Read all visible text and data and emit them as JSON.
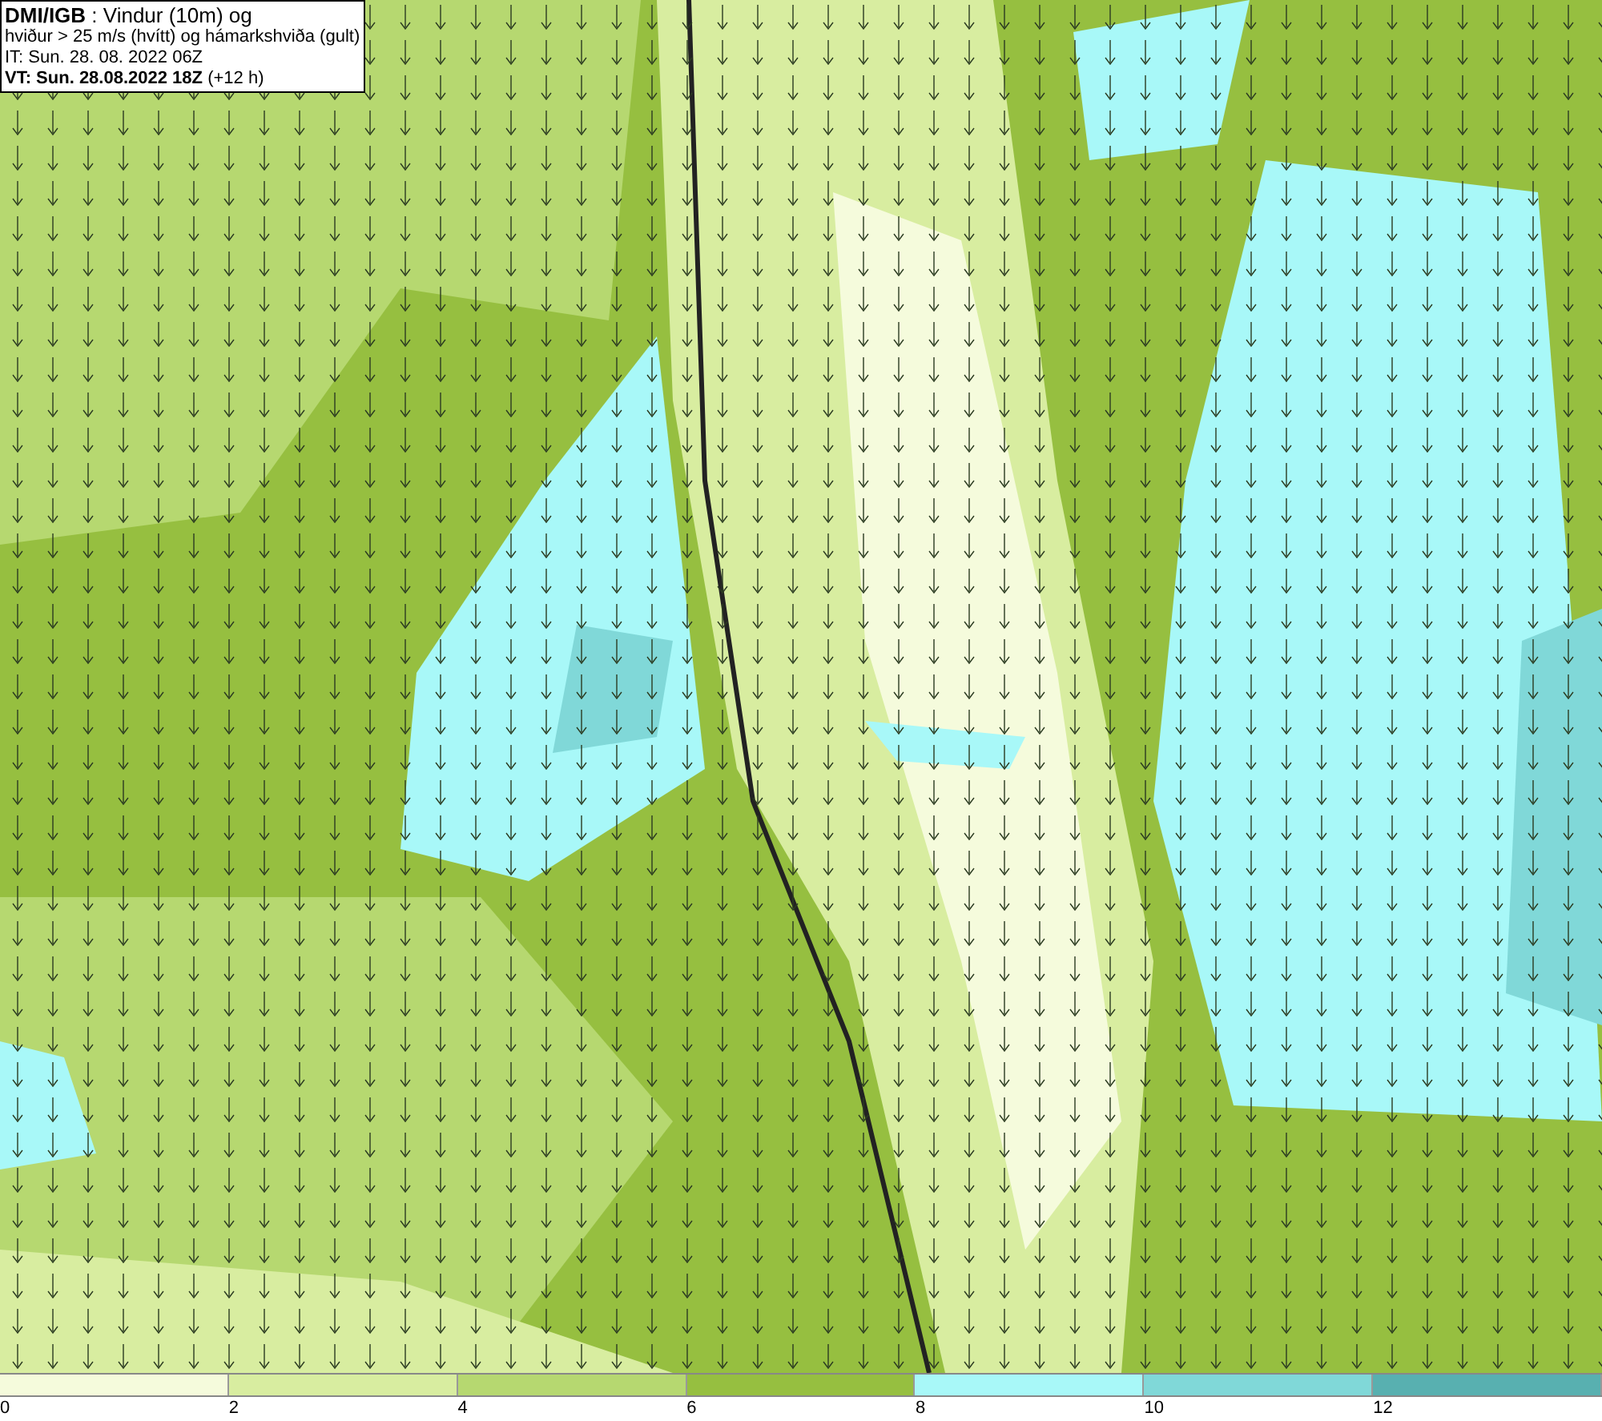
{
  "title_box": {
    "lines": [
      "**DMI/IGB** : Vindur (10m) og",
      "hviður > 25 m/s (hvítt) og hámarkshviða (gult)",
      "IT: Sun. 28. 08. 2022 06Z",
      "**VT: Sun. 28.08.2022 18Z** (+12 h)"
    ]
  },
  "legend": {
    "bins": [
      {
        "label": "0",
        "color": "#f5fbdc"
      },
      {
        "label": "2",
        "color": "#d8eda0"
      },
      {
        "label": "4",
        "color": "#b6d870"
      },
      {
        "label": "6",
        "color": "#96bf40"
      },
      {
        "label": "8",
        "color": "#a8f8f8"
      },
      {
        "label": "10",
        "color": "#80d8d8"
      },
      {
        "label": "12",
        "color": "#58b0b0"
      }
    ]
  }
}
